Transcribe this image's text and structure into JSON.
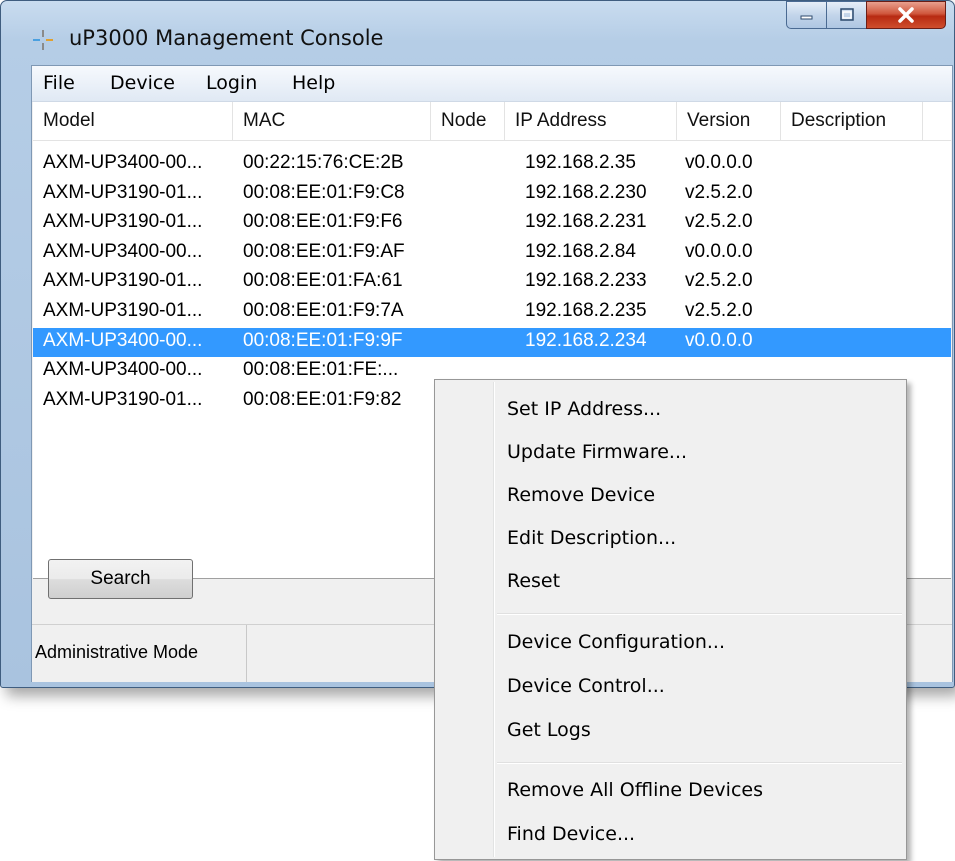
{
  "window": {
    "title": "uP3000 Management Console",
    "icon": "app-sparkle-icon"
  },
  "menubar": {
    "items": [
      "File",
      "Device",
      "Login",
      "Help"
    ]
  },
  "table": {
    "columns": [
      "Model",
      "MAC",
      "Node",
      "IP Address",
      "Version",
      "Description"
    ],
    "rows": [
      {
        "model": "AXM-UP3400-00...",
        "mac": "00:22:15:76:CE:2B",
        "node": "",
        "ip": "192.168.2.35",
        "version": "v0.0.0.0",
        "description": ""
      },
      {
        "model": "AXM-UP3190-01...",
        "mac": "00:08:EE:01:F9:C8",
        "node": "",
        "ip": "192.168.2.230",
        "version": "v2.5.2.0",
        "description": ""
      },
      {
        "model": "AXM-UP3190-01...",
        "mac": "00:08:EE:01:F9:F6",
        "node": "",
        "ip": "192.168.2.231",
        "version": "v2.5.2.0",
        "description": ""
      },
      {
        "model": "AXM-UP3400-00...",
        "mac": "00:08:EE:01:F9:AF",
        "node": "",
        "ip": "192.168.2.84",
        "version": "v0.0.0.0",
        "description": ""
      },
      {
        "model": "AXM-UP3190-01...",
        "mac": "00:08:EE:01:FA:61",
        "node": "",
        "ip": "192.168.2.233",
        "version": "v2.5.2.0",
        "description": ""
      },
      {
        "model": "AXM-UP3190-01...",
        "mac": "00:08:EE:01:F9:7A",
        "node": "",
        "ip": "192.168.2.235",
        "version": "v2.5.2.0",
        "description": ""
      },
      {
        "model": "AXM-UP3400-00...",
        "mac": "00:08:EE:01:F9:9F",
        "node": "",
        "ip": "192.168.2.234",
        "version": "v0.0.0.0",
        "description": "",
        "selected": true
      },
      {
        "model": "AXM-UP3400-00...",
        "mac": "00:08:EE:01:FE:...",
        "node": "",
        "ip": "",
        "version": "",
        "description": ""
      },
      {
        "model": "AXM-UP3190-01...",
        "mac": "00:08:EE:01:F9:82",
        "node": "",
        "ip": "",
        "version": "",
        "description": ""
      }
    ]
  },
  "search_button": "Search",
  "status": {
    "mode": "Administrative Mode"
  },
  "context_menu": {
    "groups": [
      [
        "Set IP Address...",
        "Update Firmware...",
        "Remove Device",
        "Edit Description...",
        "Reset"
      ],
      [
        "Device Configuration...",
        "Device Control...",
        "Get Logs"
      ],
      [
        "Remove All Offline Devices",
        "Find Device..."
      ]
    ]
  },
  "colors": {
    "selection": "#3399ff",
    "close_button": "#c8432a",
    "title_bar": "#b9d1ea"
  }
}
